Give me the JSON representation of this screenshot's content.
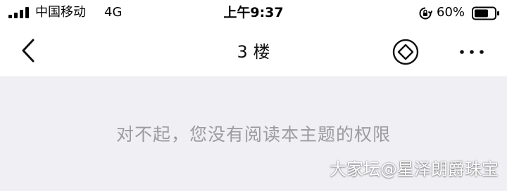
{
  "status_bar": {
    "carrier": "中国移动",
    "network": "4G",
    "time": "上午9:37",
    "battery_percent": "60%",
    "icons": [
      "signal-icon",
      "rotation-lock-icon",
      "battery-icon"
    ]
  },
  "nav": {
    "title": "3 楼",
    "icons": [
      "back-chevron-icon",
      "diamond-coin-icon",
      "more-icon"
    ]
  },
  "main": {
    "message": "对不起，您没有阅读本主题的权限"
  },
  "watermark": "大家坛@星泽朗爵珠宝",
  "colors": {
    "background": "#efeff4",
    "message_text": "#9b9ba0",
    "bar_background": "#ffffff"
  }
}
